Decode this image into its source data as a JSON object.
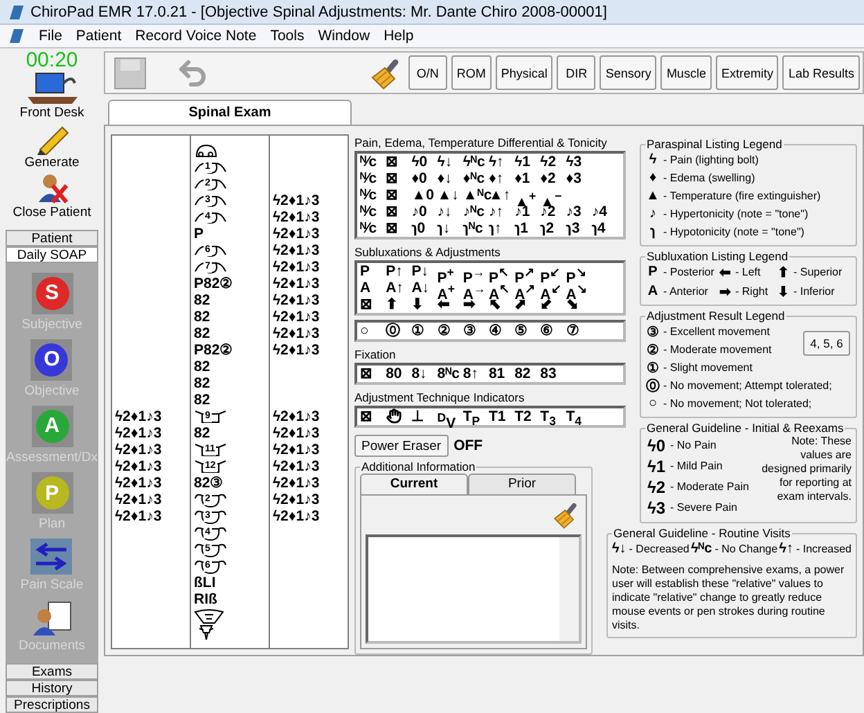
{
  "window": {
    "title": "ChiroPad EMR  17.0.21 - [Objective Spinal Adjustments:  Mr. Dante Chiro 2008-00001]"
  },
  "menu": [
    "File",
    "Patient",
    "Record Voice Note",
    "Tools",
    "Window",
    "Help"
  ],
  "sidebar": {
    "timer": "00:20",
    "actions": [
      {
        "kind": "desk",
        "label": "Front Desk"
      },
      {
        "kind": "pencil",
        "label": "Generate"
      },
      {
        "kind": "close",
        "label": "Close Patient"
      }
    ],
    "top_tabs": [
      {
        "label": "Patient",
        "selected": false
      },
      {
        "label": "Daily SOAP",
        "selected": true
      }
    ],
    "soap": [
      {
        "letter": "S",
        "label": "Subjective",
        "color": "#e02828",
        "disabled": true
      },
      {
        "letter": "O",
        "label": "Objective",
        "color": "#3838d8",
        "disabled": true
      },
      {
        "letter": "A",
        "label": "Assessment/Dx",
        "color": "#28a838",
        "disabled": true
      },
      {
        "letter": "P",
        "label": "Plan",
        "color": "#b8b820",
        "disabled": true
      },
      {
        "kind": "scale",
        "label": "Pain Scale",
        "disabled": true
      },
      {
        "kind": "docs",
        "label": "Documents",
        "disabled": true
      }
    ],
    "bottom_tabs": [
      {
        "label": "Exams",
        "selected": false
      },
      {
        "label": "History",
        "selected": false
      },
      {
        "label": "Prescriptions",
        "selected": false
      }
    ]
  },
  "toolbar_buttons": [
    "O/N",
    "ROM",
    "Physical",
    "DIR",
    "Sensory",
    "Muscle",
    "Extremity",
    "Lab Results"
  ],
  "tab": {
    "label": "Spinal Exam",
    "selected": true
  },
  "spine_rows": [
    {
      "segment": {
        "kind": "skull"
      }
    },
    {
      "segment": {
        "kind": "cervical",
        "label": "1"
      }
    },
    {
      "segment": {
        "kind": "cervical",
        "label": "2"
      }
    },
    {
      "segment": {
        "kind": "cervical",
        "label": "3"
      },
      "right": "ϟ2♦1♪3"
    },
    {
      "segment": {
        "kind": "cervical",
        "label": "4"
      },
      "right": "ϟ2♦1♪3"
    },
    {
      "segment": {
        "kind": "text",
        "text": "P"
      },
      "right": "ϟ2♦1♪3"
    },
    {
      "segment": {
        "kind": "cervical",
        "label": "6"
      },
      "right": "ϟ2♦1♪3"
    },
    {
      "segment": {
        "kind": "cervical",
        "label": "7"
      },
      "right": "ϟ2♦1♪3"
    },
    {
      "segment": {
        "kind": "text",
        "text": "P82②"
      },
      "right": "ϟ2♦1♪3"
    },
    {
      "segment": {
        "kind": "text",
        "text": "82"
      },
      "right": "ϟ2♦1♪3"
    },
    {
      "segment": {
        "kind": "text",
        "text": "82"
      },
      "right": "ϟ2♦1♪3"
    },
    {
      "segment": {
        "kind": "text",
        "text": "82"
      },
      "right": "ϟ2♦1♪3"
    },
    {
      "segment": {
        "kind": "text",
        "text": "P82②"
      },
      "right": "ϟ2♦1♪3"
    },
    {
      "segment": {
        "kind": "text",
        "text": "82"
      }
    },
    {
      "segment": {
        "kind": "text",
        "text": "82"
      }
    },
    {
      "segment": {
        "kind": "text",
        "text": "82"
      }
    },
    {
      "left": "ϟ2♦1♪3",
      "segment": {
        "kind": "thoracic",
        "label": "9"
      },
      "right": "ϟ2♦1♪3"
    },
    {
      "left": "ϟ2♦1♪3",
      "segment": {
        "kind": "text",
        "text": "82"
      },
      "right": "ϟ2♦1♪3"
    },
    {
      "left": "ϟ2♦1♪3",
      "segment": {
        "kind": "thoracic",
        "label": "11"
      },
      "right": "ϟ2♦1♪3"
    },
    {
      "left": "ϟ2♦1♪3",
      "segment": {
        "kind": "thoracic",
        "label": "12"
      },
      "right": "ϟ2♦1♪3"
    },
    {
      "left": "ϟ2♦1♪3",
      "segment": {
        "kind": "text",
        "text": "82③"
      },
      "right": "ϟ2♦1♪3"
    },
    {
      "left": "ϟ2♦1♪3",
      "segment": {
        "kind": "lumbar",
        "label": "2"
      },
      "right": "ϟ2♦1♪3"
    },
    {
      "left": "ϟ2♦1♪3",
      "segment": {
        "kind": "lumbar",
        "label": "3"
      },
      "right": "ϟ2♦1♪3"
    },
    {
      "segment": {
        "kind": "lumbar",
        "label": "4"
      }
    },
    {
      "segment": {
        "kind": "lumbar",
        "label": "5"
      }
    },
    {
      "segment": {
        "kind": "lumbar",
        "label": "6"
      }
    },
    {
      "segment": {
        "kind": "text",
        "text": "ßLI"
      }
    },
    {
      "segment": {
        "kind": "text",
        "text": "RIß"
      }
    },
    {
      "segment": {
        "kind": "sacrum"
      }
    },
    {
      "segment": {
        "kind": "coccyx"
      }
    }
  ],
  "palettes": [
    {
      "title": "Pain, Edema, Temperature Differential & Tonicity",
      "rows": [
        [
          "ᴺ⁄c",
          "⊠",
          "ϟ0",
          "ϟ↓",
          "ϟᴺc",
          "ϟ↑",
          "ϟ1",
          "ϟ2",
          "ϟ3"
        ],
        [
          "ᴺ⁄c",
          "⊠",
          "♦0",
          "♦↓",
          "♦ᴺc",
          "♦↑",
          "♦1",
          "♦2",
          "♦3"
        ],
        [
          "ᴺ⁄c",
          "⊠",
          "▲0",
          "▲↓",
          "▲ᴺc",
          "▲↑",
          "▲$^{+}$",
          "▲$^{−}$"
        ],
        [
          "ᴺ⁄c",
          "⊠",
          "♪0",
          "♪↓",
          "♪ᴺc",
          "♪↑",
          "♪1",
          "♪2",
          "♪3",
          "♪4"
        ],
        [
          "ᴺ⁄c",
          "⊠",
          "ɿ0",
          "ɿ↓",
          "ɿᴺc",
          "ɿ↑",
          "ɿ1",
          "ɿ2",
          "ɿ3",
          "ɿ4"
        ]
      ]
    },
    {
      "title": "Subluxations & Adjustments",
      "rows": [
        [
          "P",
          "P↑",
          "P↓",
          "P$^{+}$",
          "P$^{→}$",
          "P$^{↖}$",
          "P$^{↗}$",
          "P$^{↙}$",
          "P$^{↘}$"
        ],
        [
          "A",
          "A↑",
          "A↓",
          "A$^{+}$",
          "A$^{→}$",
          "A$^{↖}$",
          "A$^{↗}$",
          "A$^{↙}$",
          "A$^{↘}$"
        ],
        [
          "⊠",
          "⬆",
          "⬇",
          "⬅",
          "➡",
          "⬉",
          "⬈",
          "⬋",
          "⬊"
        ]
      ],
      "extra_row": [
        "○",
        "⓪",
        "①",
        "②",
        "③",
        "④",
        "⑤",
        "⑥",
        "⑦"
      ]
    },
    {
      "title": "Fixation",
      "rows": [
        [
          "⊠",
          "80",
          "8↓",
          "8ᴺc",
          "8↑",
          "81",
          "82",
          "83"
        ]
      ]
    },
    {
      "title": "Adjustment Technique Indicators",
      "hand_icon": true,
      "rows": [
        [
          "⊠",
          "⊥",
          "$^{D}$V",
          "T$_{P}$",
          "T1",
          "T2",
          "T$_{3}$",
          "T$_{4}$"
        ]
      ]
    }
  ],
  "power_eraser": {
    "label": "Power Eraser",
    "state": "OFF"
  },
  "additional_info": {
    "title": "Additional Information",
    "tabs": [
      {
        "label": "Current",
        "selected": true
      },
      {
        "label": "Prior",
        "selected": false
      }
    ]
  },
  "legends": {
    "paraspinal": {
      "title": "Paraspinal Listing Legend",
      "items": [
        {
          "glyph": "ϟ",
          "text": "- Pain (lighting bolt)"
        },
        {
          "glyph": "♦",
          "text": "- Edema (swelling)"
        },
        {
          "glyph": "▲",
          "text": "- Temperature (fire extinguisher)"
        },
        {
          "glyph": "♪",
          "text": "- Hypertonicity (note = \"tone\")"
        },
        {
          "glyph": "ɿ",
          "text": "- Hypotonicity (note = \"tone\")"
        }
      ]
    },
    "subluxation": {
      "title": "Subluxation Listing Legend",
      "items": [
        {
          "glyph": "P",
          "text": "- Posterior"
        },
        {
          "glyph": "⬅",
          "text": "- Left"
        },
        {
          "glyph": "⬆",
          "text": "- Superior"
        },
        {
          "glyph": "A",
          "text": "- Anterior"
        },
        {
          "glyph": "➡",
          "text": "- Right"
        },
        {
          "glyph": "⬇",
          "text": "- Inferior"
        }
      ]
    },
    "adjustment": {
      "title": "Adjustment Result Legend",
      "button": "4, 5, 6",
      "items": [
        {
          "glyph": "③",
          "text": "- Excellent movement"
        },
        {
          "glyph": "②",
          "text": "- Moderate movement"
        },
        {
          "glyph": "①",
          "text": "- Slight movement"
        },
        {
          "glyph": "⓪",
          "text": "- No movement; Attempt tolerated;"
        },
        {
          "glyph": "○",
          "text": "- No movement; Not tolerated;"
        }
      ]
    },
    "initial": {
      "title": "General Guideline - Initial & Reexams",
      "note": "Note: These values are designed primarily for reporting at exam intervals.",
      "items": [
        {
          "glyph": "ϟ0",
          "text": "- No Pain"
        },
        {
          "glyph": "ϟ1",
          "text": "- Mild Pain"
        },
        {
          "glyph": "ϟ2",
          "text": "- Moderate Pain"
        },
        {
          "glyph": "ϟ3",
          "text": "- Severe Pain"
        }
      ]
    },
    "routine": {
      "title": "General Guideline - Routine Visits",
      "items": [
        {
          "glyph": "ϟ↓",
          "text": "- Decreased"
        },
        {
          "glyph": "ϟᴺc",
          "text": "- No Change"
        },
        {
          "glyph": "ϟ↑",
          "text": "- Increased"
        }
      ],
      "note": "Note: Between comprehensive exams, a power user will establish these \"relative\" values to indicate \"relative\" change to greatly reduce mouse events or pen strokes during routine visits."
    }
  }
}
